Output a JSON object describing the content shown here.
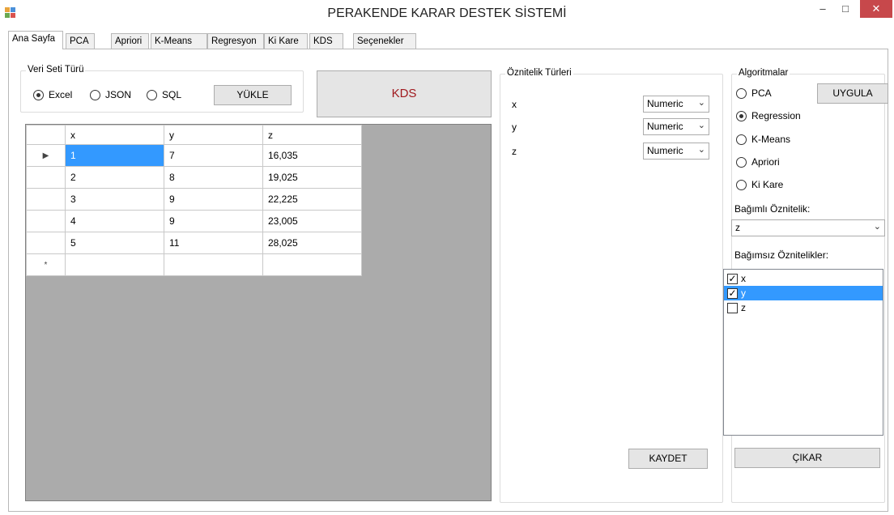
{
  "window": {
    "title": "PERAKENDE KARAR DESTEK SİSTEMİ",
    "minimize_glyph": "–",
    "maximize_glyph": "□",
    "close_glyph": "✕"
  },
  "tabs": [
    "Ana Sayfa",
    "PCA",
    "Apriori",
    "K-Means",
    "Regresyon",
    "Ki Kare",
    "KDS",
    "Seçenekler"
  ],
  "dataset_type": {
    "title": "Veri Seti Türü",
    "options": [
      "Excel",
      "JSON",
      "SQL"
    ],
    "selected": "Excel",
    "load_button": "YÜKLE"
  },
  "kds_button": "KDS",
  "kds_button_color": "#a0191e",
  "grid": {
    "columns": [
      "x",
      "y",
      "z"
    ],
    "rows": [
      [
        "1",
        "7",
        "16,035"
      ],
      [
        "2",
        "8",
        "19,025"
      ],
      [
        "3",
        "9",
        "22,225"
      ],
      [
        "4",
        "9",
        "23,005"
      ],
      [
        "5",
        "11",
        "28,025"
      ]
    ],
    "current_row_marker": "▶",
    "new_row_marker": "*"
  },
  "attribute_types": {
    "title": "Öznitelik Türleri",
    "items": [
      {
        "name": "x",
        "type": "Numeric"
      },
      {
        "name": "y",
        "type": "Numeric"
      },
      {
        "name": "z",
        "type": "Numeric"
      }
    ],
    "save_button": "KAYDET"
  },
  "algorithms": {
    "title": "Algoritmalar",
    "options": [
      "PCA",
      "Regression",
      "K-Means",
      "Apriori",
      "Ki Kare"
    ],
    "selected": "Regression",
    "apply_button": "UYGULA",
    "dependent_label": "Bağımlı Öznitelik:",
    "dependent_value": "z",
    "independent_label": "Bağımsız Öznitelikler:",
    "independent_items": [
      {
        "name": "x",
        "checked": true,
        "selected": false
      },
      {
        "name": "y",
        "checked": true,
        "selected": true
      },
      {
        "name": "z",
        "checked": false,
        "selected": false
      }
    ],
    "remove_button": "ÇIKAR"
  },
  "colors": {
    "accent": "#3399ff",
    "close": "#c7484b"
  }
}
